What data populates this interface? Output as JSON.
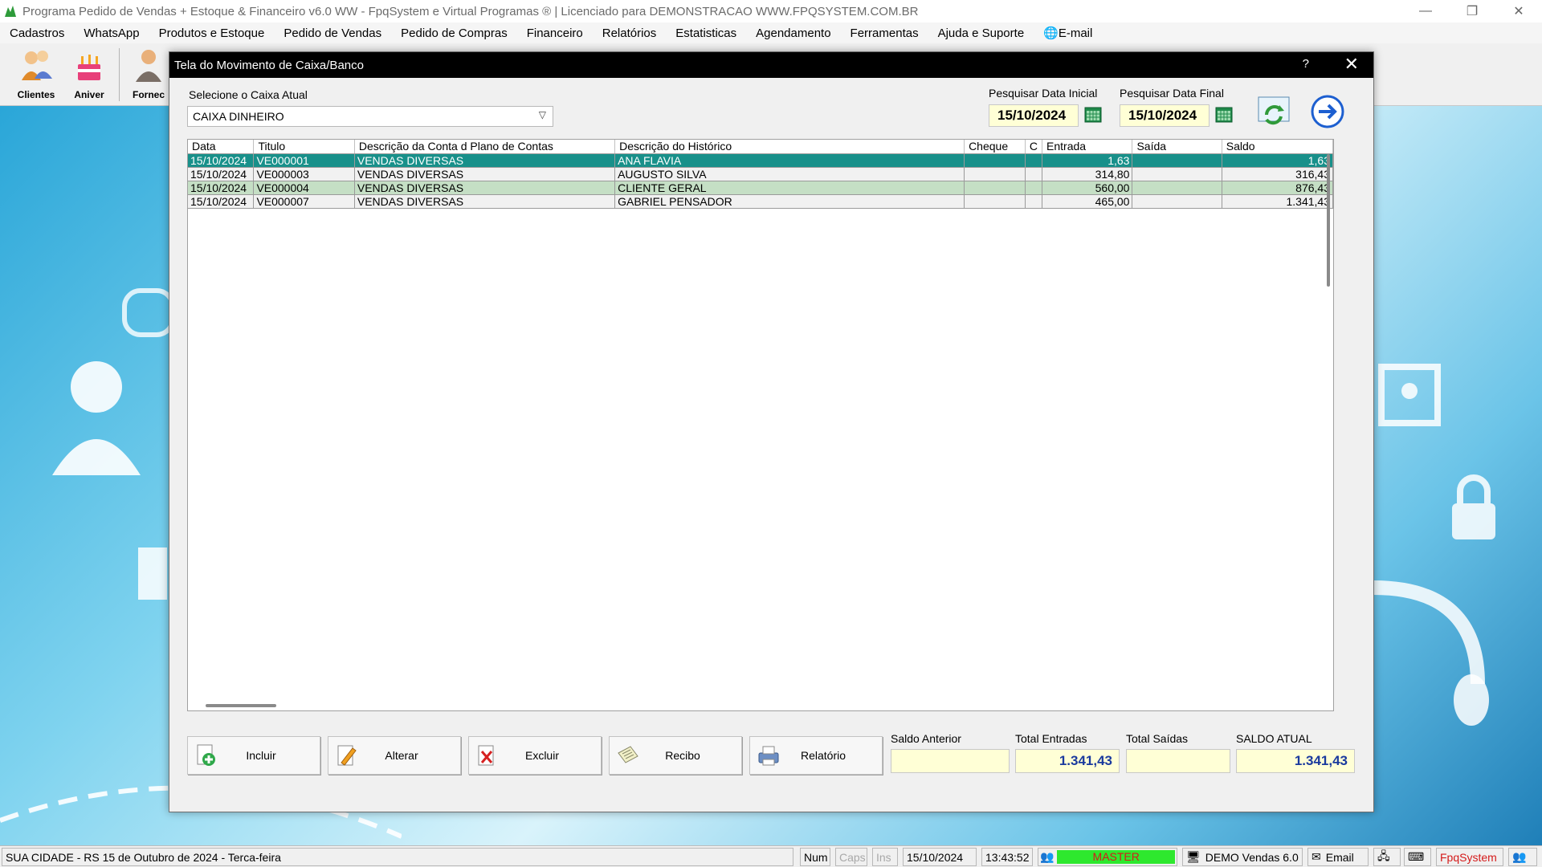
{
  "window": {
    "title": "Programa Pedido de Vendas + Estoque & Financeiro v6.0 WW - FpqSystem e Virtual Programas ® | Licenciado para  DEMONSTRACAO WWW.FPQSYSTEM.COM.BR"
  },
  "menu": [
    "Cadastros",
    "WhatsApp",
    "Produtos e Estoque",
    "Pedido de Vendas",
    "Pedido de Compras",
    "Financeiro",
    "Relatórios",
    "Estatisticas",
    "Agendamento",
    "Ferramentas",
    "Ajuda e Suporte",
    "E-mail"
  ],
  "toolbar": {
    "clientes": "Clientes",
    "aniver": "Aniver",
    "fornec": "Fornec"
  },
  "dialog": {
    "title": "Tela do Movimento de Caixa/Banco",
    "help": "?",
    "close": "✕",
    "caixa_label": "Selecione o Caixa Atual",
    "caixa_value": "CAIXA DINHEIRO",
    "data_inicial_label": "Pesquisar Data Inicial",
    "data_inicial": "15/10/2024",
    "data_final_label": "Pesquisar Data Final",
    "data_final": "15/10/2024"
  },
  "grid": {
    "headers": [
      "Data",
      "Titulo",
      "Descrição da Conta d Plano de Contas",
      "Descrição do Histórico",
      "Cheque",
      "C",
      "Entrada",
      "Saída",
      "Saldo"
    ],
    "rows": [
      [
        "15/10/2024",
        "VE000001",
        "VENDAS DIVERSAS",
        "ANA FLAVIA",
        "",
        "",
        "1,63",
        "",
        "1,63"
      ],
      [
        "15/10/2024",
        "VE000003",
        "VENDAS DIVERSAS",
        "AUGUSTO SILVA",
        "",
        "",
        "314,80",
        "",
        "316,43"
      ],
      [
        "15/10/2024",
        "VE000004",
        "VENDAS DIVERSAS",
        "CLIENTE GERAL",
        "",
        "",
        "560,00",
        "",
        "876,43"
      ],
      [
        "15/10/2024",
        "VE000007",
        "VENDAS DIVERSAS",
        "GABRIEL PENSADOR",
        "",
        "",
        "465,00",
        "",
        "1.341,43"
      ]
    ]
  },
  "buttons": {
    "incluir": "Incluir",
    "alterar": "Alterar",
    "excluir": "Excluir",
    "recibo": "Recibo",
    "relatorio": "Relatório"
  },
  "totals": {
    "saldo_anterior_label": "Saldo Anterior",
    "saldo_anterior": "",
    "total_entradas_label": "Total Entradas",
    "total_entradas": "1.341,43",
    "total_saidas_label": "Total Saídas",
    "total_saidas": "",
    "saldo_atual_label": "SALDO ATUAL",
    "saldo_atual": "1.341,43"
  },
  "status": {
    "location": "SUA CIDADE - RS 15 de Outubro de 2024 - Terca-feira",
    "num": "Num",
    "caps": "Caps",
    "ins": "Ins",
    "date": "15/10/2024",
    "time": "13:43:52",
    "user": "MASTER",
    "version": "DEMO Vendas 6.0",
    "email": "Email",
    "brand": "FpqSystem"
  }
}
